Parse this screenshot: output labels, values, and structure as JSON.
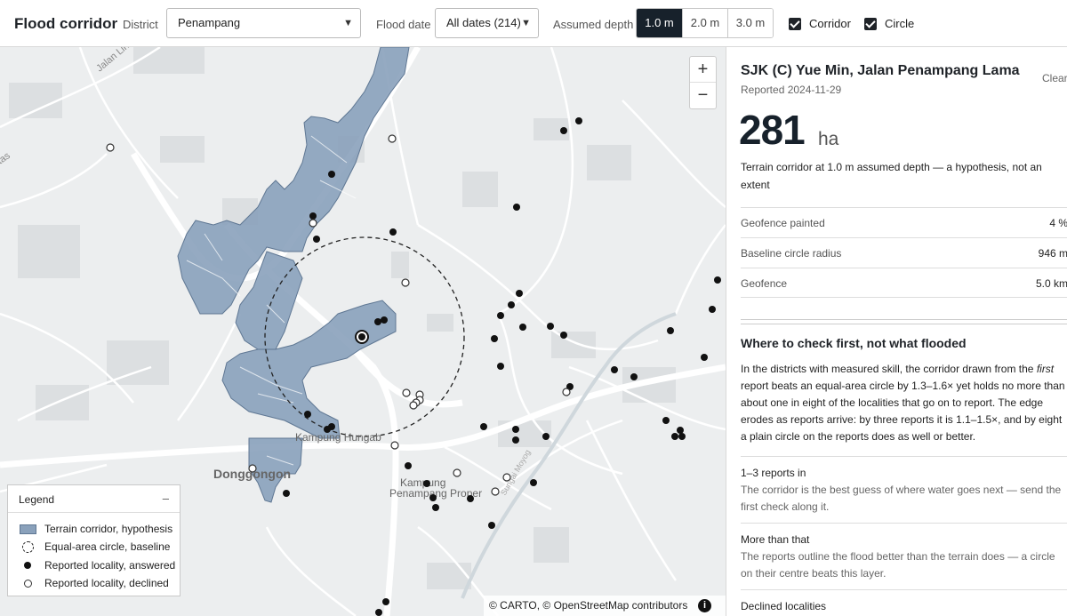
{
  "topbar": {
    "title": "Flood corridor",
    "district_label": "District",
    "district_value": "Penampang",
    "date_label": "Flood date",
    "date_value": "All dates (214)",
    "depth_label": "Assumed depth",
    "depth_options": [
      "1.0 m",
      "2.0 m",
      "3.0 m"
    ],
    "depth_selected": "1.0 m",
    "corridor_label": "Corridor",
    "corridor_checked": true,
    "circle_label": "Circle",
    "circle_checked": true
  },
  "map": {
    "place_labels": {
      "kampung_hungab": "Kampung Hungab",
      "donggongon": "Donggongon",
      "kampung_penampang_1": "Kampung",
      "kampung_penampang_2": "Penampang Proper",
      "jalan_lintas": "Jalan Lintas",
      "tas": "tas",
      "river": "Sungai Moyog"
    },
    "zoom_in": "+",
    "zoom_out": "−",
    "legend": {
      "title": "Legend",
      "toggle": "–",
      "items": [
        "Terrain corridor, hypothesis",
        "Equal-area circle, baseline",
        "Reported locality, answered",
        "Reported locality, declined"
      ]
    },
    "attribution": "© CARTO, © OpenStreetMap contributors",
    "colors": {
      "corridor": "#8aa1bb",
      "corridor_stroke": "#5f7793",
      "answered": "#111111",
      "declined": "#ffffff"
    }
  },
  "panel": {
    "place": "SJK (C) Yue Min, Jalan Penampang Lama",
    "clear": "Clear",
    "reported": "Reported 2024-11-29",
    "area_value": "281",
    "area_unit": "ha",
    "description": "Terrain corridor at 1.0 m assumed depth — a hypothesis, not an extent",
    "stats": [
      {
        "key": "Geofence painted",
        "value": "4 %"
      },
      {
        "key": "Baseline circle radius",
        "value": "946 m"
      },
      {
        "key": "Geofence",
        "value": "5.0 km"
      }
    ],
    "heading": "Where to check first, not what flooded",
    "para_a": "In the districts with measured skill, the corridor drawn from the",
    "para_em": "first",
    "para_b": "report beats an equal-area circle by 1.3–1.6× yet holds no more than about one in eight of the localities that go on to report. The edge erodes as reports arrive: by three reports it is 1.1–1.5×, and by eight a plain circle on the reports does as well or better.",
    "sections": [
      {
        "title": "1–3 reports in",
        "text": "The corridor is the best guess of where water goes next — send the first check along it."
      },
      {
        "title": "More than that",
        "text": "The reports outline the flood better than the terrain does — a circle on their centre beats this layer."
      },
      {
        "title": "Declined localities",
        "text": ""
      }
    ]
  }
}
